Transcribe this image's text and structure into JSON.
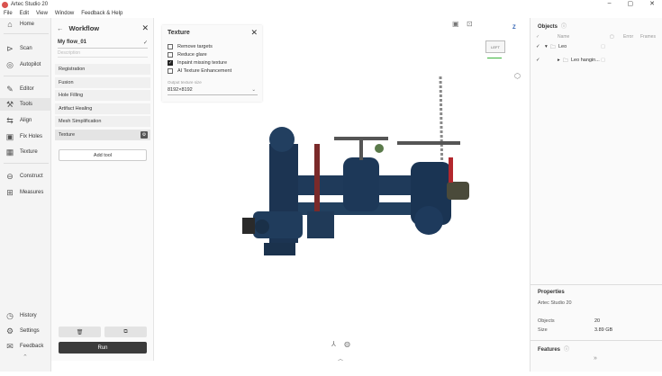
{
  "window": {
    "title": "Artec Studio 20",
    "minimize": "–",
    "maximize": "▢",
    "close": "✕"
  },
  "menu": [
    "File",
    "Edit",
    "View",
    "Window",
    "Feedback & Help"
  ],
  "nav": {
    "home": "Home",
    "scan": "Scan",
    "autopilot": "Autopilot",
    "editor": "Editor",
    "tools": "Tools",
    "align": "Align",
    "fix_holes": "Fix Holes",
    "texture": "Texture",
    "construct": "Construct",
    "measures": "Measures",
    "history": "History",
    "settings": "Settings",
    "feedback": "Feedback"
  },
  "workflow": {
    "title": "Workflow",
    "name": "My flow_01",
    "description_placeholder": "Description",
    "steps": [
      "Registration",
      "Fusion",
      "Hole Filling",
      "Artifact Healing",
      "Mesh Simplification",
      "Texture"
    ],
    "add_tool": "Add tool",
    "run": "Run"
  },
  "texture_panel": {
    "title": "Texture",
    "options": [
      {
        "label": "Remove targets",
        "checked": false
      },
      {
        "label": "Reduce glare",
        "checked": false
      },
      {
        "label": "Inpaint missing texture",
        "checked": true
      },
      {
        "label": "AI Texture Enhancement",
        "checked": false
      }
    ],
    "size_label": "Output texture size",
    "size_value": "8192×8192"
  },
  "viewcube": {
    "face": "LEFT",
    "axis_z": "Z"
  },
  "objects": {
    "title": "Objects",
    "columns": {
      "name": "Name",
      "error": "Error",
      "frames": "Frames"
    },
    "rows": [
      {
        "name": "Leo",
        "checked": true
      },
      {
        "name": "Leo hangin...",
        "checked": true
      }
    ]
  },
  "properties": {
    "title": "Properties",
    "app": "Artec Studio 20",
    "objects_label": "Objects",
    "objects_value": "20",
    "size_label": "Size",
    "size_value": "3.89 GB"
  },
  "features": {
    "title": "Features"
  },
  "colors": {
    "run_bg": "#3b3b3b",
    "scan_blue": "#1f3a5a",
    "accent_red": "#c0392b"
  }
}
